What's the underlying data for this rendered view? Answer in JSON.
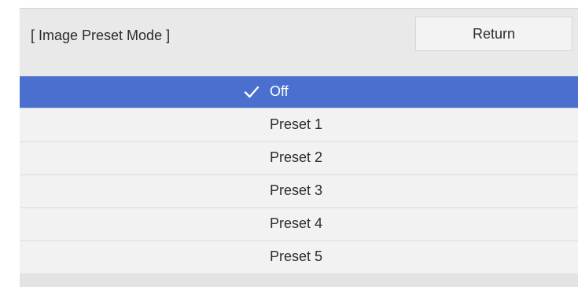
{
  "dialog": {
    "title": "[ Image Preset Mode ]",
    "return_label": "Return"
  },
  "options": [
    {
      "label": "Off",
      "selected": true
    },
    {
      "label": "Preset 1",
      "selected": false
    },
    {
      "label": "Preset 2",
      "selected": false
    },
    {
      "label": "Preset 3",
      "selected": false
    },
    {
      "label": "Preset 4",
      "selected": false
    },
    {
      "label": "Preset 5",
      "selected": false
    }
  ],
  "colors": {
    "selected_background": "#4a6fcf",
    "panel_background": "#e9e9e9"
  },
  "icons": {
    "selected_marker": "checkmark-icon"
  }
}
